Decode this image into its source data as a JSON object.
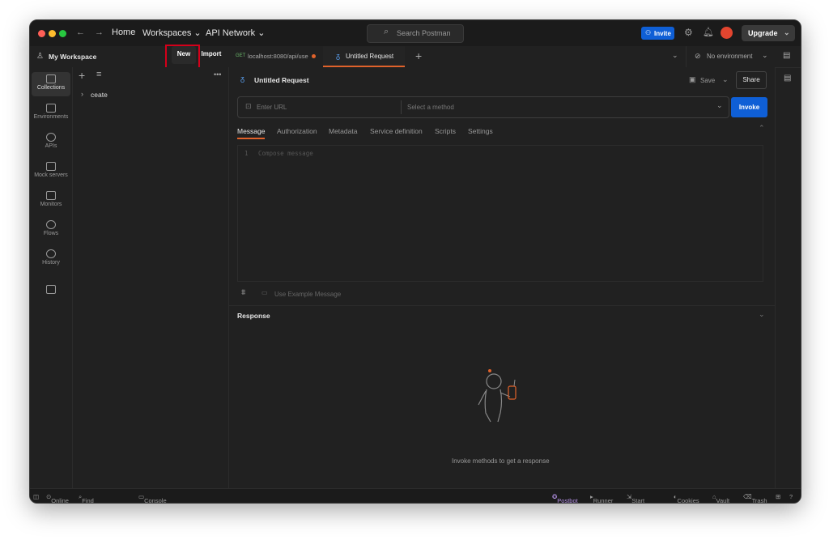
{
  "titlebar": {
    "home": "Home",
    "workspaces": "Workspaces",
    "api_network": "API Network",
    "search_placeholder": "Search Postman",
    "invite": "Invite",
    "upgrade": "Upgrade"
  },
  "workspace": {
    "name": "My Workspace",
    "new_button": "New",
    "import_button": "Import"
  },
  "tabs": [
    {
      "method": "GET",
      "label": "localhost:8080/api/use"
    },
    {
      "label": "Untitled Request"
    }
  ],
  "environment": {
    "label": "No environment"
  },
  "rail": [
    {
      "label": "Collections"
    },
    {
      "label": "Environments"
    },
    {
      "label": "APIs"
    },
    {
      "label": "Mock servers"
    },
    {
      "label": "Monitors"
    },
    {
      "label": "Flows"
    },
    {
      "label": "History"
    }
  ],
  "sidebar": {
    "items": [
      "ceate"
    ]
  },
  "request": {
    "title": "Untitled Request",
    "save": "Save",
    "share": "Share",
    "url_placeholder": "Enter URL",
    "method_placeholder": "Select a method",
    "invoke": "Invoke",
    "subtabs": [
      "Message",
      "Authorization",
      "Metadata",
      "Service definition",
      "Scripts",
      "Settings"
    ],
    "line_number": "1",
    "compose_placeholder": "Compose message",
    "use_example": "Use Example Message"
  },
  "response": {
    "title": "Response",
    "empty_text": "Invoke methods to get a response"
  },
  "statusbar": {
    "online": "Online",
    "find_replace": "Find and replace",
    "console": "Console",
    "postbot": "Postbot",
    "runner": "Runner",
    "start_proxy": "Start Proxy",
    "cookies": "Cookies",
    "vault": "Vault",
    "trash": "Trash"
  },
  "colors": {
    "accent": "#0f5fd6",
    "highlight": "#d4001a",
    "tab_underline": "#e0622b"
  }
}
